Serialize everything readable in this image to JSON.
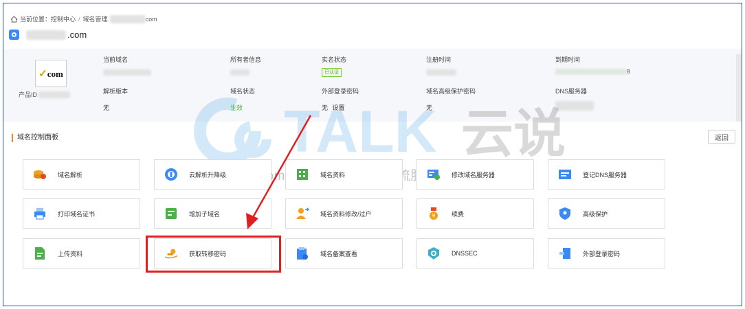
{
  "breadcrumb": {
    "prefix": "当前位置：",
    "item1": "控制中心",
    "sep": "/",
    "item2": "域名管理",
    "item3_suffix": "com"
  },
  "domain": {
    "suffix": ".com"
  },
  "info": {
    "logo_text": "com",
    "product_id_label": "产品ID",
    "headers_row1": [
      "当前域名",
      "所有者信息",
      "实名状态",
      "注册时间",
      "到期时间"
    ],
    "realname_badge": "已认证",
    "expire_tail": "8",
    "headers_row2": [
      "解析版本",
      "域名状态",
      "外部登录密码",
      "域名高级保护密码",
      "DNS服务器"
    ],
    "resolve_version": "无",
    "domain_status": "生效",
    "ext_pwd": "无",
    "ext_pwd_link": "设置",
    "adv_pwd": "无"
  },
  "panel": {
    "title": "域名控制面板",
    "back": "返回"
  },
  "cards": [
    {
      "label": "域名解析",
      "icon": "dns-resolve-icon",
      "color": "#f0a020"
    },
    {
      "label": "云解析升降级",
      "icon": "cloud-dns-upgrade-icon",
      "color": "#3b8af3"
    },
    {
      "label": "域名资料",
      "icon": "domain-info-icon",
      "color": "#4cb04a"
    },
    {
      "label": "修改域名服务器",
      "icon": "modify-dns-server-icon",
      "color": "#3b8af3"
    },
    {
      "label": "登记DNS服务器",
      "icon": "register-dns-icon",
      "color": "#3b8af3"
    },
    {
      "label": "打印域名证书",
      "icon": "print-icon",
      "color": "#3b8af3"
    },
    {
      "label": "增加子域名",
      "icon": "add-subdomain-icon",
      "color": "#4cb04a"
    },
    {
      "label": "域名资料修改/过户",
      "icon": "transfer-owner-icon",
      "color": "#f0a020"
    },
    {
      "label": "续费",
      "icon": "renew-icon",
      "color": "#f0a020"
    },
    {
      "label": "高级保护",
      "icon": "shield-icon",
      "color": "#3b8af3"
    },
    {
      "label": "上传资料",
      "icon": "upload-doc-icon",
      "color": "#4cb04a"
    },
    {
      "label": "获取转移密码",
      "icon": "transfer-password-icon",
      "color": "#f0a020"
    },
    {
      "label": "域名备案查看",
      "icon": "icp-record-icon",
      "color": "#3b8af3"
    },
    {
      "label": "DNSSEC",
      "icon": "dnssec-icon",
      "color": "#3bb0c8"
    },
    {
      "label": "外部登录密码",
      "icon": "external-login-icon",
      "color": "#3b8af3"
    }
  ],
  "watermark": {
    "brand": "TALK",
    "cn": "云说",
    "url": "www.idctalk.com-国内专业云计算交流服务平台-"
  }
}
